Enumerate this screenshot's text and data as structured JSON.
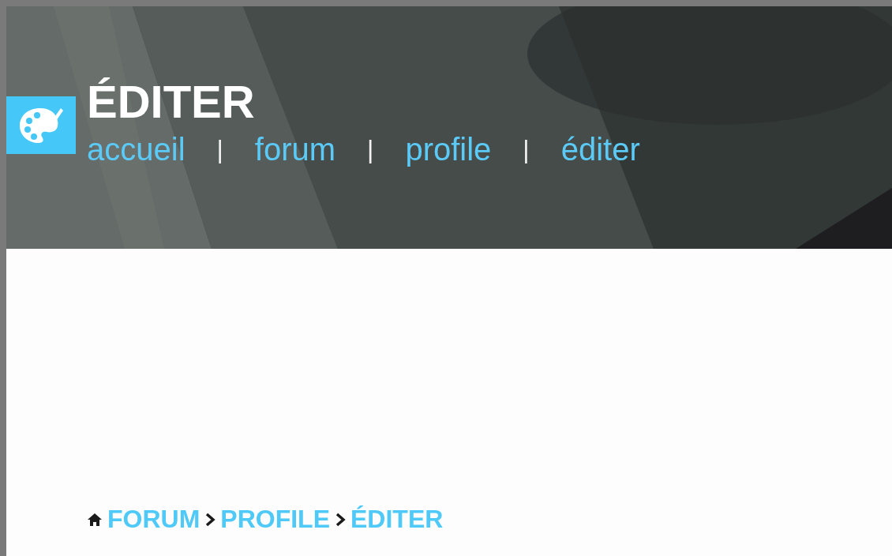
{
  "header": {
    "title": "ÉDITER",
    "nav": [
      {
        "kind": "link",
        "text": "accueil"
      },
      {
        "kind": "separator",
        "text": "|"
      },
      {
        "kind": "link",
        "text": "forum"
      },
      {
        "kind": "separator",
        "text": "|"
      },
      {
        "kind": "link",
        "text": "profile"
      },
      {
        "kind": "separator",
        "text": "|"
      },
      {
        "kind": "link",
        "text": "éditer"
      }
    ]
  },
  "breadcrumb": [
    "FORUM",
    "PROFILE",
    "ÉDITER"
  ]
}
